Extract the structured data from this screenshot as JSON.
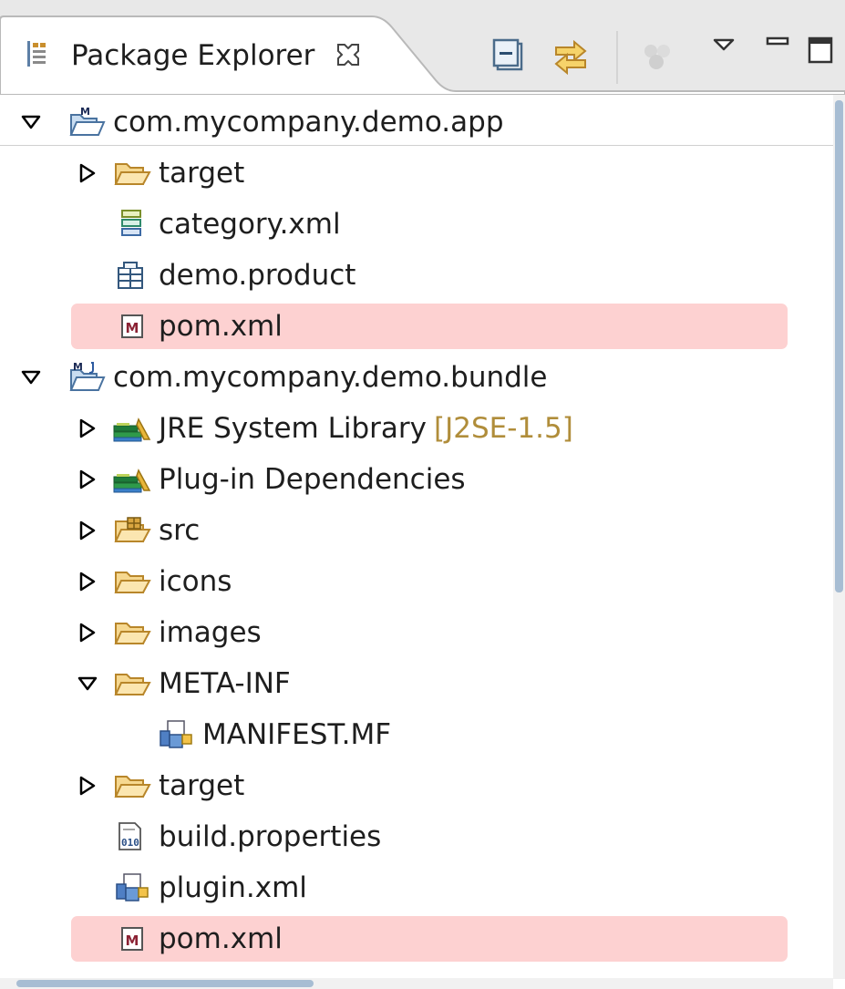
{
  "view": {
    "tab_title": "Package Explorer",
    "tab_icon": "package-explorer-icon",
    "tab_close_icon": "close-tab-icon",
    "toolbar": [
      "collapse-all-icon",
      "link-with-editor-icon",
      "scm-disabled-icon",
      "view-menu-icon",
      "minimize-icon",
      "maximize-icon"
    ]
  },
  "tree": [
    {
      "label": "com.mycompany.demo.app",
      "icon": "maven-project-icon",
      "state": "expanded"
    },
    {
      "label": "target",
      "icon": "folder-icon",
      "state": "collapsed"
    },
    {
      "label": "category.xml",
      "icon": "category-xml-icon"
    },
    {
      "label": "demo.product",
      "icon": "product-file-icon"
    },
    {
      "label": "pom.xml",
      "icon": "maven-pom-icon",
      "selected": true
    },
    {
      "label": "com.mycompany.demo.bundle",
      "icon": "maven-plugin-project-icon",
      "state": "expanded"
    },
    {
      "label": "JRE System Library",
      "decoration": "[J2SE-1.5]",
      "icon": "library-icon",
      "state": "collapsed"
    },
    {
      "label": "Plug-in Dependencies",
      "icon": "library-icon",
      "state": "collapsed"
    },
    {
      "label": "src",
      "icon": "source-folder-icon",
      "state": "collapsed"
    },
    {
      "label": "icons",
      "icon": "folder-icon",
      "state": "collapsed"
    },
    {
      "label": "images",
      "icon": "folder-icon",
      "state": "collapsed"
    },
    {
      "label": "META-INF",
      "icon": "folder-icon",
      "state": "expanded"
    },
    {
      "label": "MANIFEST.MF",
      "icon": "manifest-icon"
    },
    {
      "label": "target",
      "icon": "folder-icon",
      "state": "collapsed"
    },
    {
      "label": "build.properties",
      "icon": "properties-file-icon"
    },
    {
      "label": "plugin.xml",
      "icon": "plugin-xml-icon"
    },
    {
      "label": "pom.xml",
      "icon": "maven-pom-icon",
      "selected": true
    }
  ],
  "colors": {
    "selection": "#fdd1d1",
    "decoration": "#b08d3a",
    "folder": "#e3b55a",
    "scrollbar_thumb": "#a7bdd3"
  }
}
